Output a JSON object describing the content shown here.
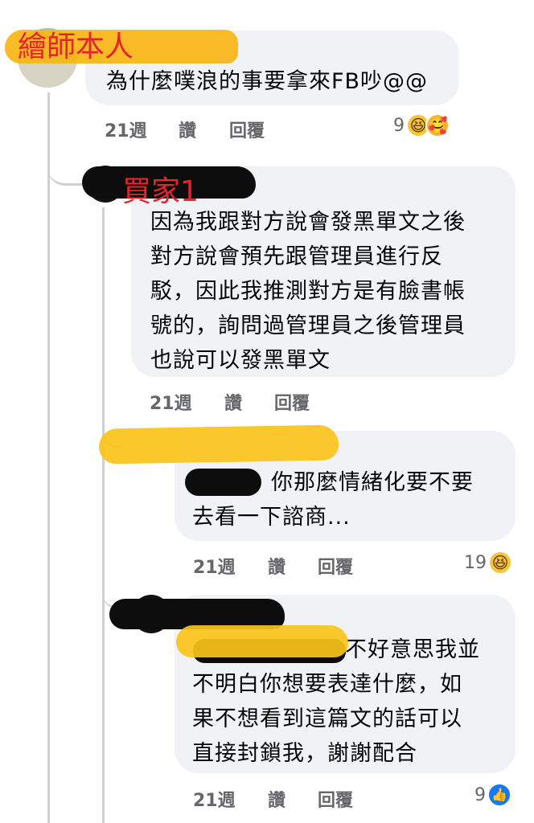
{
  "comments": [
    {
      "author_label": "繪師本人",
      "text_lines": [
        "為什麼噗浪的事要拿來FB吵@@"
      ],
      "meta": {
        "time": "21週",
        "like": "讚",
        "reply": "回覆"
      },
      "reactions": {
        "count": "9",
        "icons": [
          "haha-emoji",
          "care-emoji"
        ]
      }
    },
    {
      "author_label": "買家1",
      "text_lines": [
        "因為我跟對方說會發黑單文之後",
        "對方說會預先跟管理員進行反",
        "駁，因此我推測對方是有臉書帳",
        "號的，詢問過管理員之後管理員",
        "也說可以發黑單文"
      ],
      "meta": {
        "time": "21週",
        "like": "讚",
        "reply": "回覆"
      }
    },
    {
      "author_label": "",
      "text_lines": [
        "你那麼情緒化要不要",
        "去看一下諮商..."
      ],
      "meta": {
        "time": "21週",
        "like": "讚",
        "reply": "回覆"
      },
      "reactions": {
        "count": "19",
        "icons": [
          "haha-emoji"
        ]
      }
    },
    {
      "author_label": "",
      "text_lines": [
        "不好意思我並",
        "不明白你想要表達什麼，如",
        "果不想看到這篇文的話可以",
        "直接封鎖我，謝謝配合"
      ],
      "meta": {
        "time": "21週",
        "like": "讚",
        "reply": "回覆"
      },
      "reactions": {
        "count": "9",
        "icons": [
          "like-emoji"
        ]
      }
    }
  ],
  "colors": {
    "bubble": "#f0f2f5",
    "meta_text": "#65676b",
    "highlight_orange": "#f9b615",
    "highlight_yellow": "#fbc31a",
    "label_red": "#e8222c",
    "redaction": "#0d0d0d",
    "like_blue": "#1877f2"
  }
}
